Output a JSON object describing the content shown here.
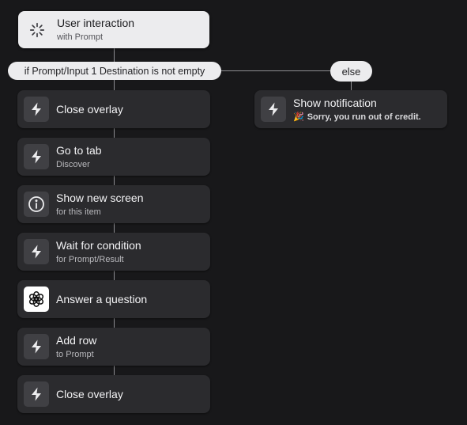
{
  "trigger": {
    "title": "User interaction",
    "subtitle": "with Prompt",
    "icon": "loading-spinner-icon"
  },
  "condition": {
    "label": "if Prompt/Input 1 Destination is not empty",
    "else_label": "else"
  },
  "main_branch": [
    {
      "title": "Close overlay",
      "subtitle": "",
      "icon": "lightning-icon"
    },
    {
      "title": "Go to tab",
      "subtitle": "Discover",
      "icon": "lightning-icon"
    },
    {
      "title": "Show new screen",
      "subtitle": "for this item",
      "icon": "info-icon"
    },
    {
      "title": "Wait for condition",
      "subtitle": "for Prompt/Result",
      "icon": "lightning-icon"
    },
    {
      "title": "Answer a question",
      "subtitle": "",
      "icon": "openai-icon"
    },
    {
      "title": "Add row",
      "subtitle": "to Prompt",
      "icon": "lightning-icon"
    },
    {
      "title": "Close overlay",
      "subtitle": "",
      "icon": "lightning-icon"
    }
  ],
  "else_branch": [
    {
      "title": "Show notification",
      "subtitle": "Sorry, you run out of credit.",
      "icon": "lightning-icon",
      "emoji": "🎉"
    }
  ],
  "colors": {
    "background": "#18181a",
    "card": "#2b2b2e",
    "light_card": "#ececee",
    "connector": "#8e8e92"
  }
}
